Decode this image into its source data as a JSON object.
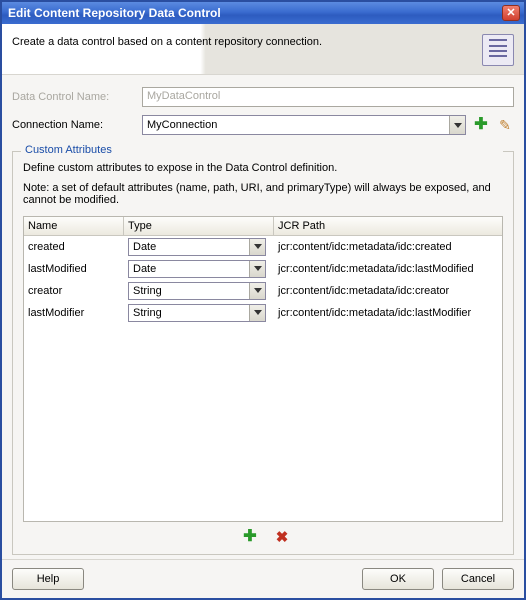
{
  "window": {
    "title": "Edit Content Repository Data Control"
  },
  "header": {
    "description": "Create a data control based on a content repository connection."
  },
  "form": {
    "dataControlNameLabel": "Data Control Name:",
    "dataControlNameValue": "MyDataControl",
    "connectionNameLabel": "Connection Name:",
    "connectionNameValue": "MyConnection"
  },
  "customAttributes": {
    "legend": "Custom Attributes",
    "description": "Define custom attributes to expose in the Data Control definition.",
    "note": "Note: a set of default attributes (name, path, URI, and primaryType) will always be exposed, and cannot be modified.",
    "columns": {
      "name": "Name",
      "type": "Type",
      "jcrPath": "JCR Path"
    },
    "rows": [
      {
        "name": "created",
        "type": "Date",
        "jcrPath": "jcr:content/idc:metadata/idc:created"
      },
      {
        "name": "lastModified",
        "type": "Date",
        "jcrPath": "jcr:content/idc:metadata/idc:lastModified"
      },
      {
        "name": "creator",
        "type": "String",
        "jcrPath": "jcr:content/idc:metadata/idc:creator"
      },
      {
        "name": "lastModifier",
        "type": "String",
        "jcrPath": "jcr:content/idc:metadata/idc:lastModifier"
      }
    ]
  },
  "buttons": {
    "help": "Help",
    "ok": "OK",
    "cancel": "Cancel"
  }
}
